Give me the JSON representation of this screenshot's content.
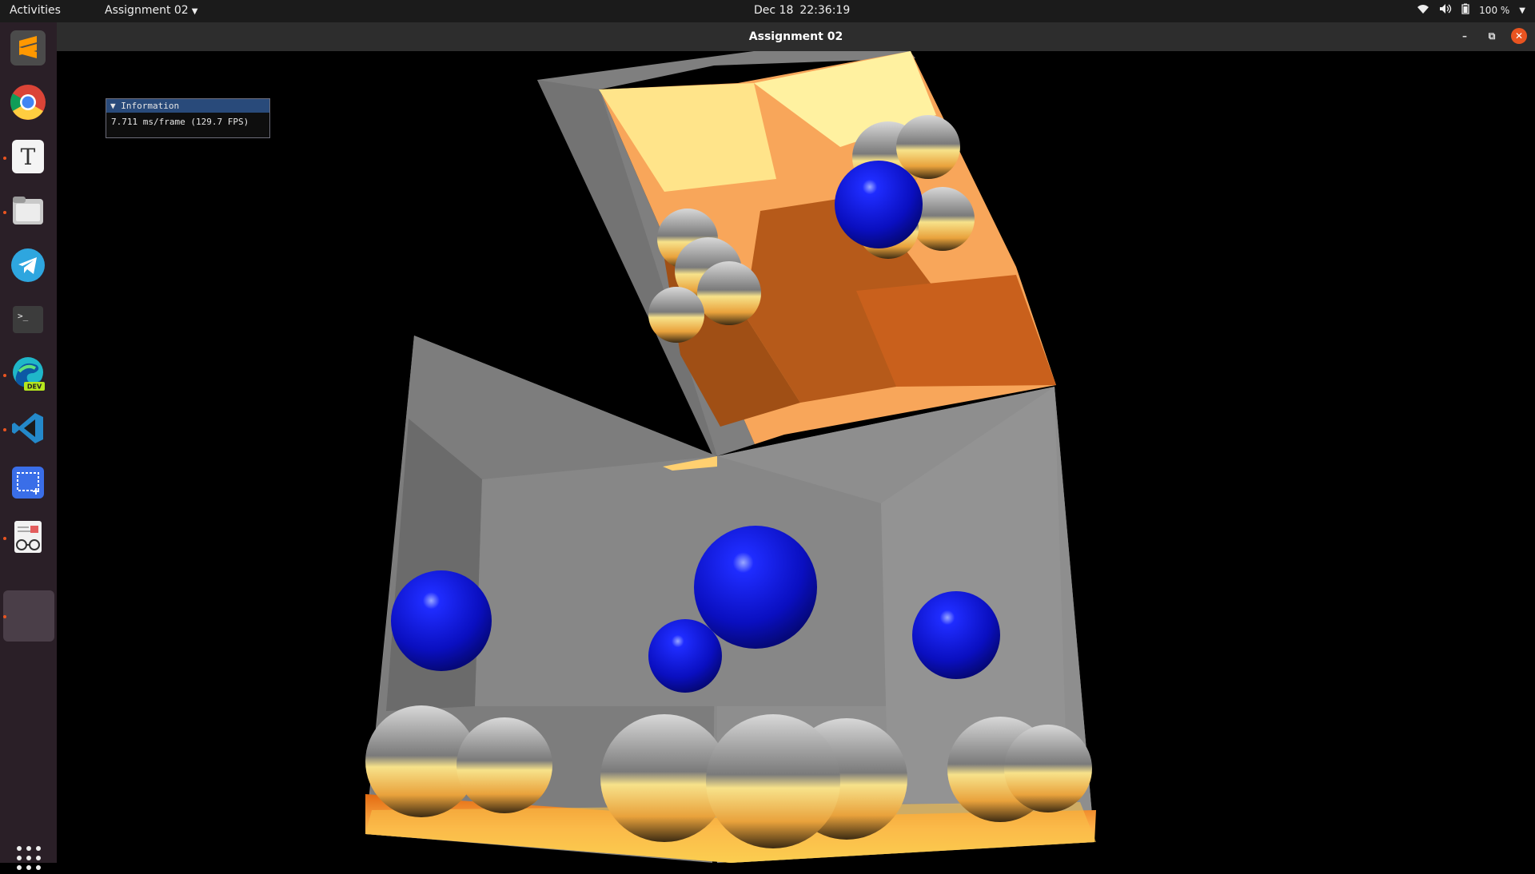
{
  "topbar": {
    "activities": "Activities",
    "app_menu": "Assignment 02",
    "date": "Dec 18",
    "time": "22:36:19",
    "battery": "100 %"
  },
  "dock": {
    "items": [
      "Sublime Text",
      "Google Chrome",
      "Typora",
      "Files",
      "Telegram",
      "Terminal",
      "Microsoft Edge Dev",
      "Visual Studio Code",
      "Screenshot",
      "Document Viewer",
      "Assignment 02"
    ],
    "edge_badge": "DEV"
  },
  "window": {
    "title": "Assignment 02"
  },
  "imgui": {
    "header": "Information",
    "stats": "7.711 ms/frame (129.7 FPS)"
  },
  "colors": {
    "accent": "#e95420",
    "imgui_header": "#294a7a"
  }
}
